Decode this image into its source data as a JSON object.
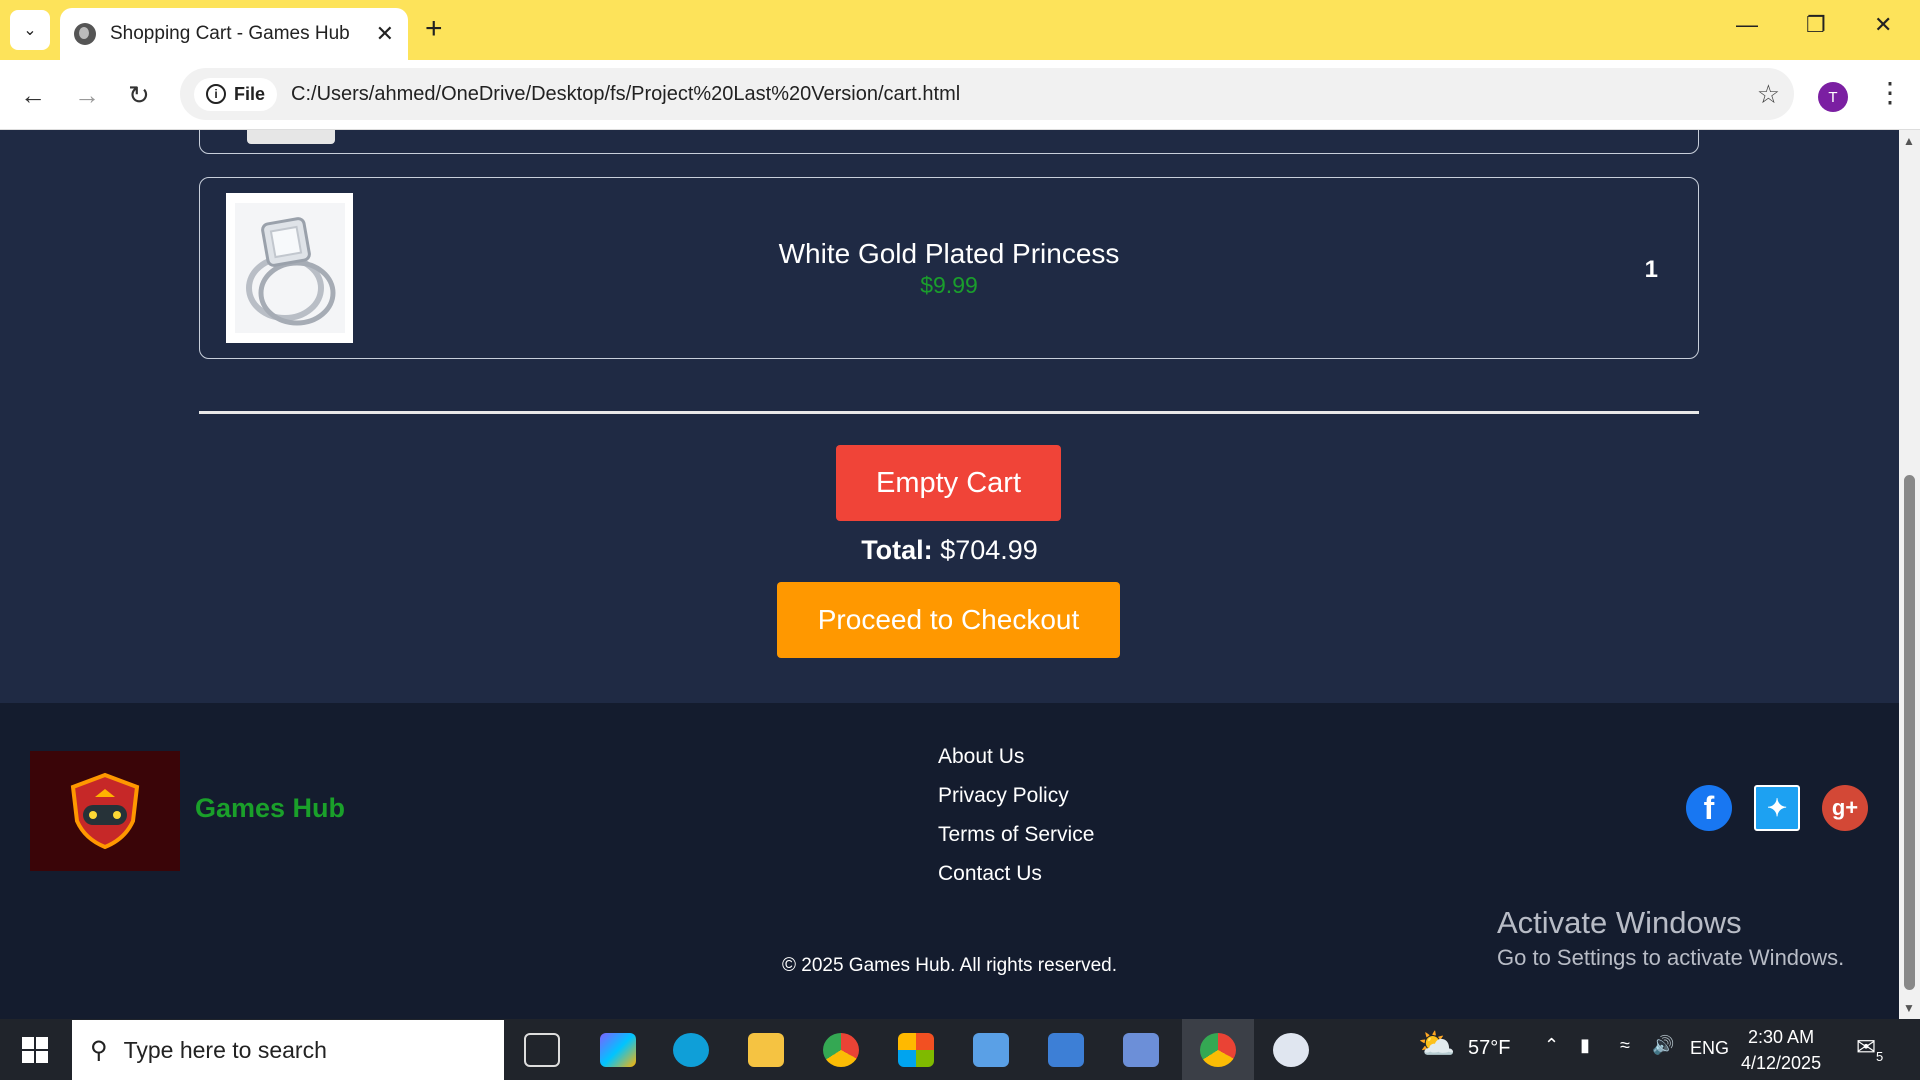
{
  "browser": {
    "tab_title": "Shopping Cart - Games Hub",
    "file_label": "File",
    "url": "C:/Users/ahmed/OneDrive/Desktop/fs/Project%20Last%20Version/cart.html",
    "profile_initial": "T"
  },
  "cart": {
    "items": [
      {
        "name": "White Gold Plated Princess",
        "price": "$9.99",
        "quantity": "1"
      }
    ],
    "empty_button": "Empty Cart",
    "total_label": "Total:",
    "total_value": "$704.99",
    "checkout_button": "Proceed to Checkout"
  },
  "footer": {
    "brand": "Games Hub",
    "links": [
      "About Us",
      "Privacy Policy",
      "Terms of Service",
      "Contact Us"
    ],
    "copyright": "© 2025 Games Hub. All rights reserved."
  },
  "watermark": {
    "line1": "Activate Windows",
    "line2": "Go to Settings to activate Windows."
  },
  "taskbar": {
    "search_placeholder": "Type here to search",
    "weather": "57°F",
    "language": "ENG",
    "time": "2:30 AM",
    "date": "4/12/2025",
    "notification_count": "5"
  },
  "colors": {
    "page_bg": "#1f2a44",
    "footer_bg": "#141c2e",
    "empty_button": "#f04438",
    "checkout_button": "#ff9800",
    "price": "#1a9e2c",
    "brand": "#1aa02a",
    "browser_frame": "#fde35a"
  }
}
